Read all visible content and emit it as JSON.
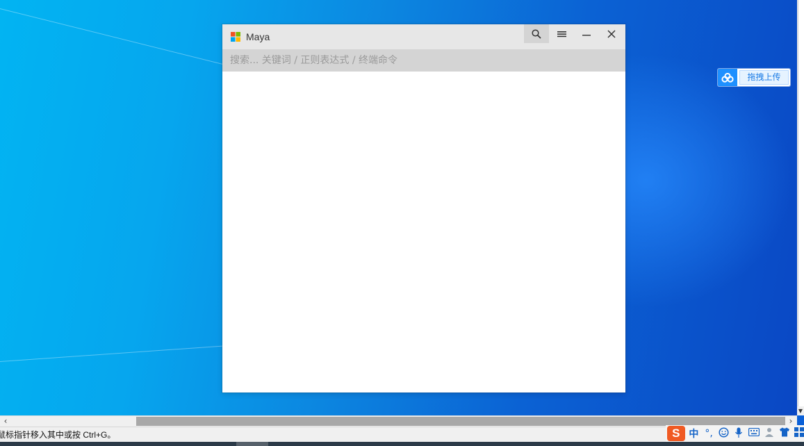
{
  "window": {
    "title": "Maya",
    "search_placeholder": "搜索... 关键词 / 正则表达式 / 终端命令",
    "search_value": ""
  },
  "cloud_widget": {
    "label": "拖拽上传"
  },
  "statusbar": {
    "message": "鼠标指针移入其中或按 Ctrl+G。"
  },
  "ime": {
    "mode_label": "中",
    "punct_label": "°,"
  },
  "colors": {
    "desktop_light": "#02b4f2",
    "desktop_dark": "#0a47c4",
    "titlebar": "#e7e7e7",
    "searchbar": "#d4d4d4",
    "cloud_blue": "#1e90ff",
    "sogou_orange": "#f05a23"
  },
  "icons": {
    "app_logo": "windows-logo-icon",
    "search": "search-icon",
    "menu": "hamburger-menu-icon",
    "minimize": "minimize-icon",
    "close": "close-icon",
    "cloud": "baidu-cloud-icon"
  }
}
